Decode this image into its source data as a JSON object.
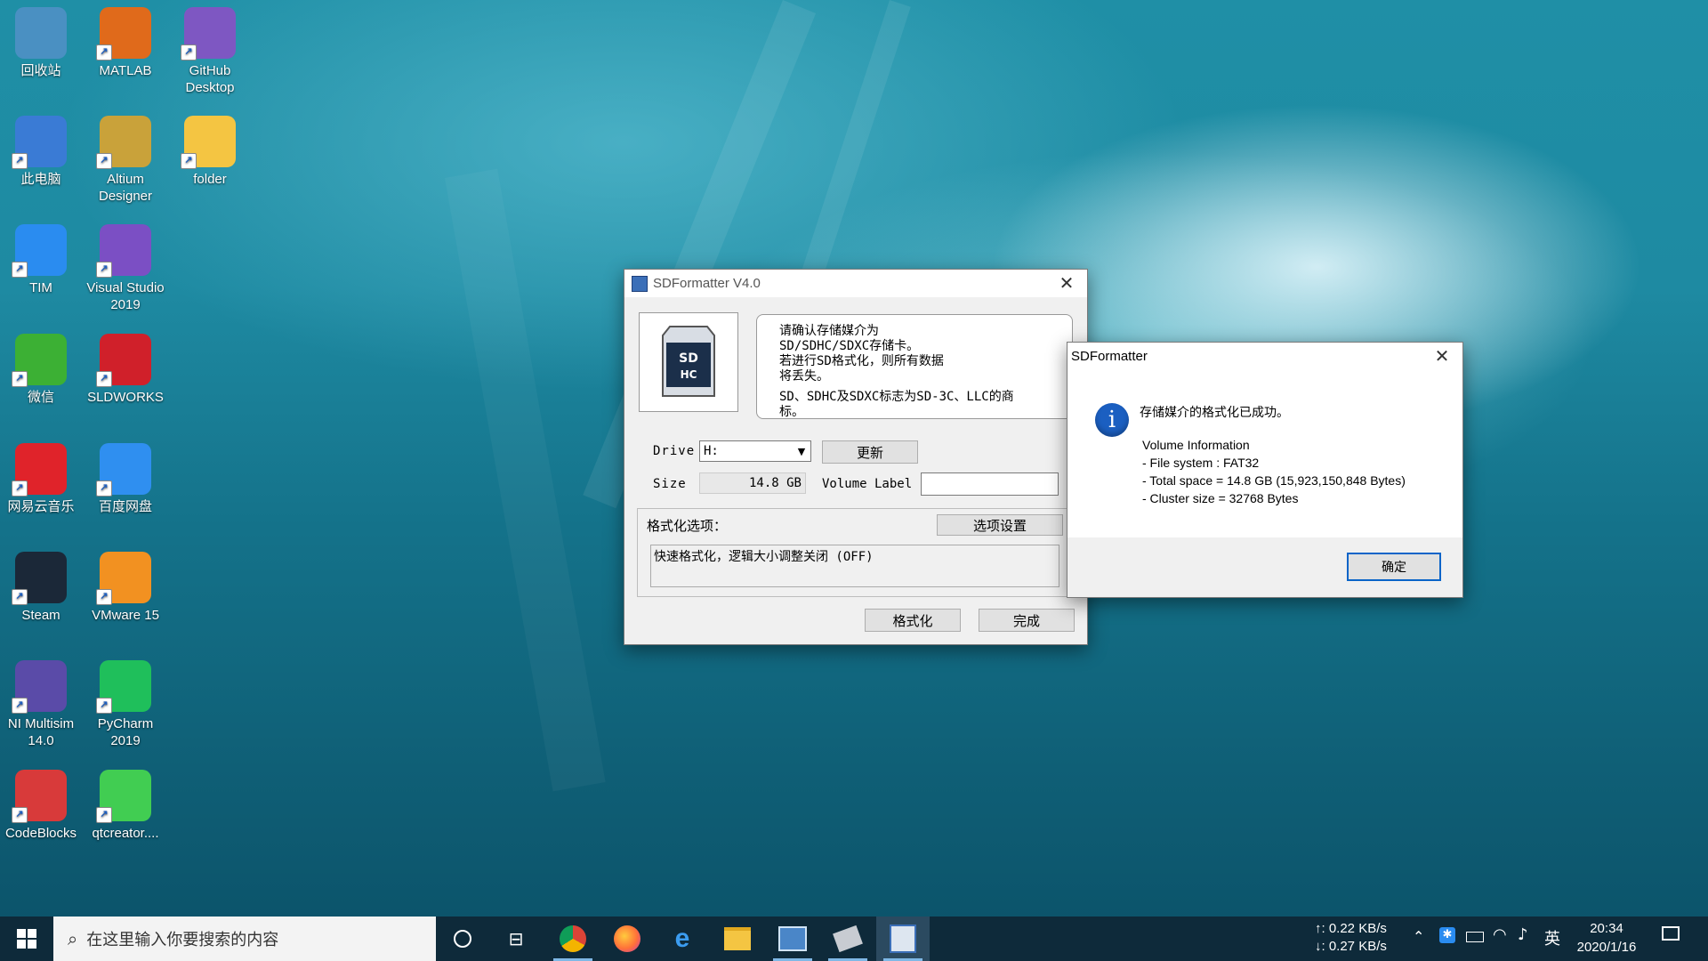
{
  "desktop": {
    "icons": [
      {
        "label": "回收站",
        "color": "#4a90c2"
      },
      {
        "label": "MATLAB",
        "color": "#e06a1b"
      },
      {
        "label": "GitHub Desktop",
        "color": "#7e57c2"
      },
      {
        "label": "此电脑",
        "color": "#3a7bd5"
      },
      {
        "label": "Altium Designer",
        "color": "#c9a23a"
      },
      {
        "label": "folder",
        "color": "#f4c542"
      },
      {
        "label": "TIM",
        "color": "#2a8cf0"
      },
      {
        "label": "Visual Studio 2019",
        "color": "#7b4fc4"
      },
      {
        "label": "微信",
        "color": "#3cb034"
      },
      {
        "label": "SLDWORKS",
        "color": "#d0202a"
      },
      {
        "label": "网易云音乐",
        "color": "#e0232a"
      },
      {
        "label": "百度网盘",
        "color": "#2f8ff0"
      },
      {
        "label": "Steam",
        "color": "#1b2838"
      },
      {
        "label": "VMware 15",
        "color": "#f29121"
      },
      {
        "label": "NI Multisim 14.0",
        "color": "#5a4ba8"
      },
      {
        "label": "PyCharm 2019",
        "color": "#1fbf5b"
      },
      {
        "label": "CodeBlocks",
        "color": "#d83a3a"
      },
      {
        "label": "qtcreator....",
        "color": "#41cd52"
      }
    ]
  },
  "sdformatter": {
    "title": "SDFormatter V4.0",
    "notice_line1": "请确认存储媒介为",
    "notice_line2": "SD/SDHC/SDXC存储卡。",
    "notice_line3": "若进行SD格式化，则所有数据",
    "notice_line4": "将丢失。",
    "notice_line5": "SD、SDHC及SDXC标志为SD-3C、LLC的商",
    "notice_line6": "标。",
    "drive_label": "Drive",
    "drive_value": "H:",
    "refresh_button": "更新",
    "size_label": "Size",
    "size_value": "14.8 GB",
    "volume_label": "Volume Label",
    "volume_value": "",
    "options_title": "格式化选项：",
    "options_button": "选项设置",
    "options_text": "快速格式化，逻辑大小调整关闭 (OFF)",
    "format_button": "格式化",
    "done_button": "完成"
  },
  "dialog": {
    "title": "SDFormatter",
    "message": "存储媒介的格式化已成功。",
    "info_title": "Volume Information",
    "info_fs": "- File system : FAT32",
    "info_total": "- Total space = 14.8 GB (15,923,150,848 Bytes)",
    "info_cluster": "- Cluster size = 32768 Bytes",
    "ok_button": "确定"
  },
  "taskbar": {
    "search_placeholder": "在这里输入你要搜索的内容",
    "net_up": "↑: 0.22 KB/s",
    "net_down": "↓: 0.27 KB/s",
    "ime": "英",
    "time": "20:34",
    "date": "2020/1/16"
  }
}
